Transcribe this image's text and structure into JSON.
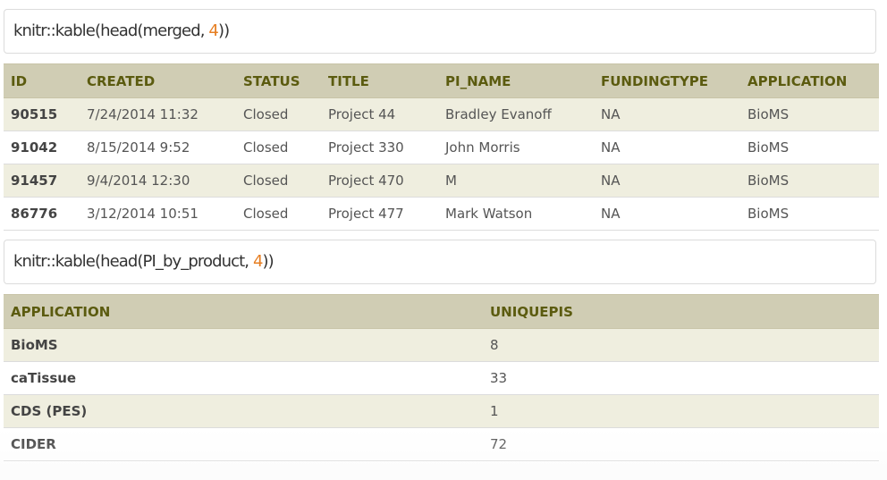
{
  "code1": {
    "prefix": "knitr::kable(head(merged, ",
    "number": "4",
    "suffix": "))"
  },
  "table1": {
    "headers": [
      "ID",
      "CREATED",
      "STATUS",
      "TITLE",
      "PI_NAME",
      "FUNDINGTYPE",
      "APPLICATION"
    ],
    "rows": [
      [
        "90515",
        "7/24/2014 11:32",
        "Closed",
        "Project 44",
        "Bradley Evanoff",
        "NA",
        "BioMS"
      ],
      [
        "91042",
        "8/15/2014 9:52",
        "Closed",
        "Project 330",
        "John Morris",
        "NA",
        "BioMS"
      ],
      [
        "91457",
        "9/4/2014 12:30",
        "Closed",
        "Project 470",
        "M",
        "NA",
        "BioMS"
      ],
      [
        "86776",
        "3/12/2014 10:51",
        "Closed",
        "Project 477",
        "Mark Watson",
        "NA",
        "BioMS"
      ]
    ]
  },
  "code2": {
    "prefix": "knitr::kable(head(PI_by_product, ",
    "number": "4",
    "suffix": "))"
  },
  "table2": {
    "headers": [
      "APPLICATION",
      "UNIQUEPIS"
    ],
    "rows": [
      [
        "BioMS",
        "8"
      ],
      [
        "caTissue",
        "33"
      ],
      [
        "CDS (PES)",
        "1"
      ],
      [
        "CIDER",
        "72"
      ]
    ]
  },
  "colors": {
    "header_bg": "#d0cdb4",
    "header_text": "#5b5b0f",
    "stripe_bg": "#efeedf",
    "number_accent": "#e67e22"
  }
}
